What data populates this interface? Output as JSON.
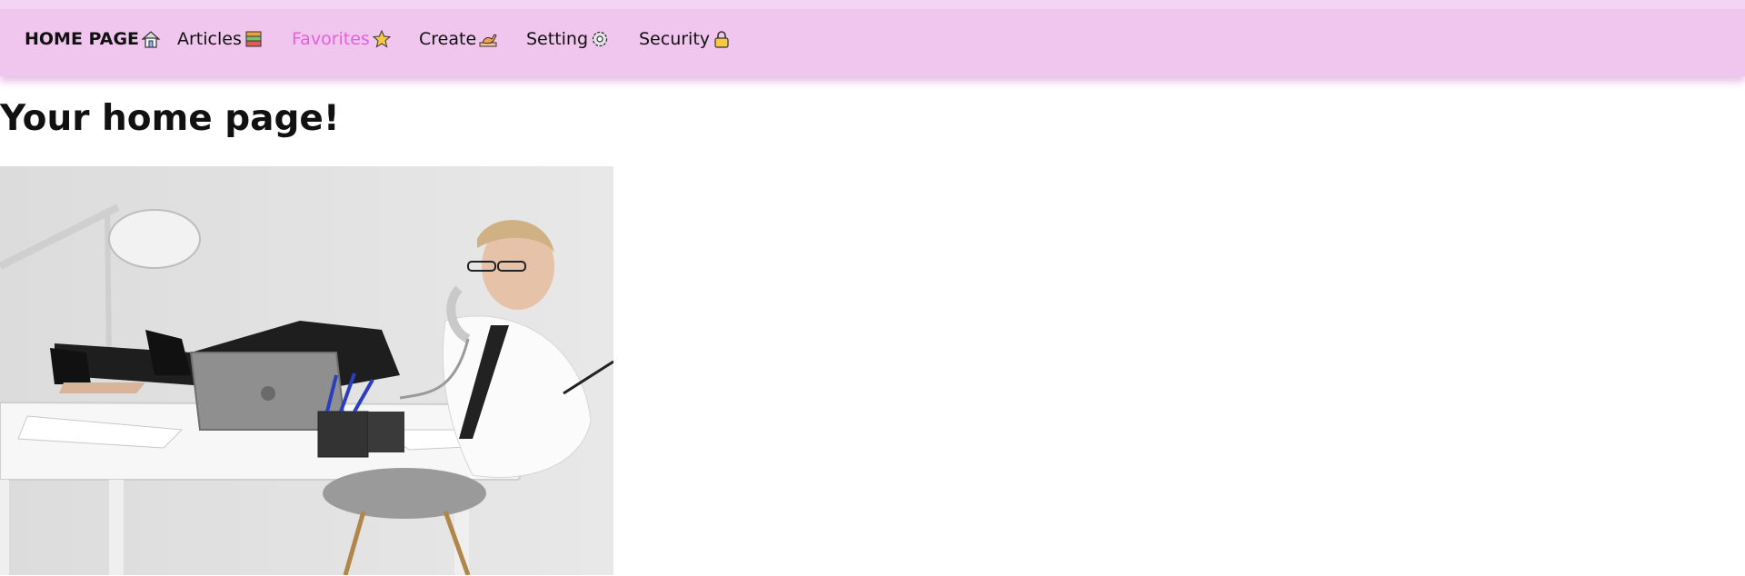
{
  "nav": {
    "items": [
      {
        "label": "HOME PAGE",
        "icon": "house-icon"
      },
      {
        "label": "Articles",
        "icon": "books-icon"
      },
      {
        "label": "Favorites",
        "icon": "star-icon",
        "active": true
      },
      {
        "label": "Create",
        "icon": "writing-hand-icon"
      },
      {
        "label": "Setting",
        "icon": "gear-icon"
      },
      {
        "label": "Security",
        "icon": "lock-icon"
      }
    ],
    "background": "#f0c6ef",
    "active_color": "#e561d6"
  },
  "main": {
    "title": "Your home page!",
    "image": {
      "alt": "woman at office desk on phone with laptop"
    }
  }
}
